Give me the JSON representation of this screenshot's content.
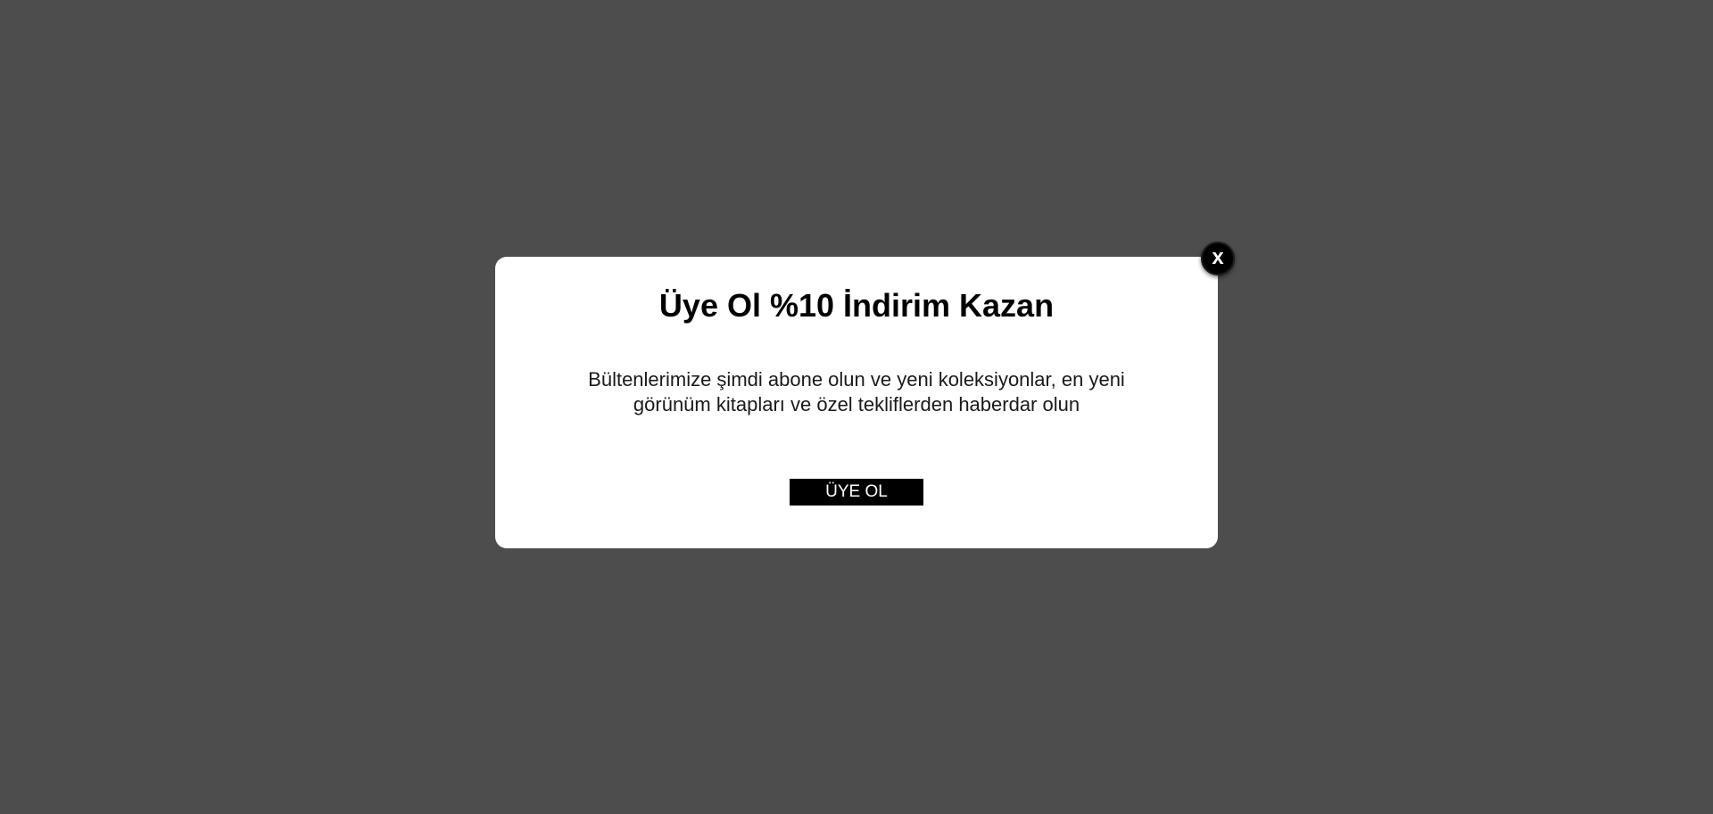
{
  "colors": {
    "overlay": "#4d4d4d",
    "modal_background": "#ffffff",
    "button_background": "#000000",
    "button_text": "#ffffff",
    "close_button_background": "#000000"
  },
  "popup": {
    "title": "Üye Ol %10 İndirim Kazan",
    "description_line1": "Bültenlerimize şimdi abone olun ve yeni koleksiyonlar, en yeni",
    "description_line2": "görünüm kitapları ve özel tekliflerden haberdar olun",
    "signup_button_label": "ÜYE OL",
    "close_icon": "close-icon",
    "close_label": "x"
  }
}
